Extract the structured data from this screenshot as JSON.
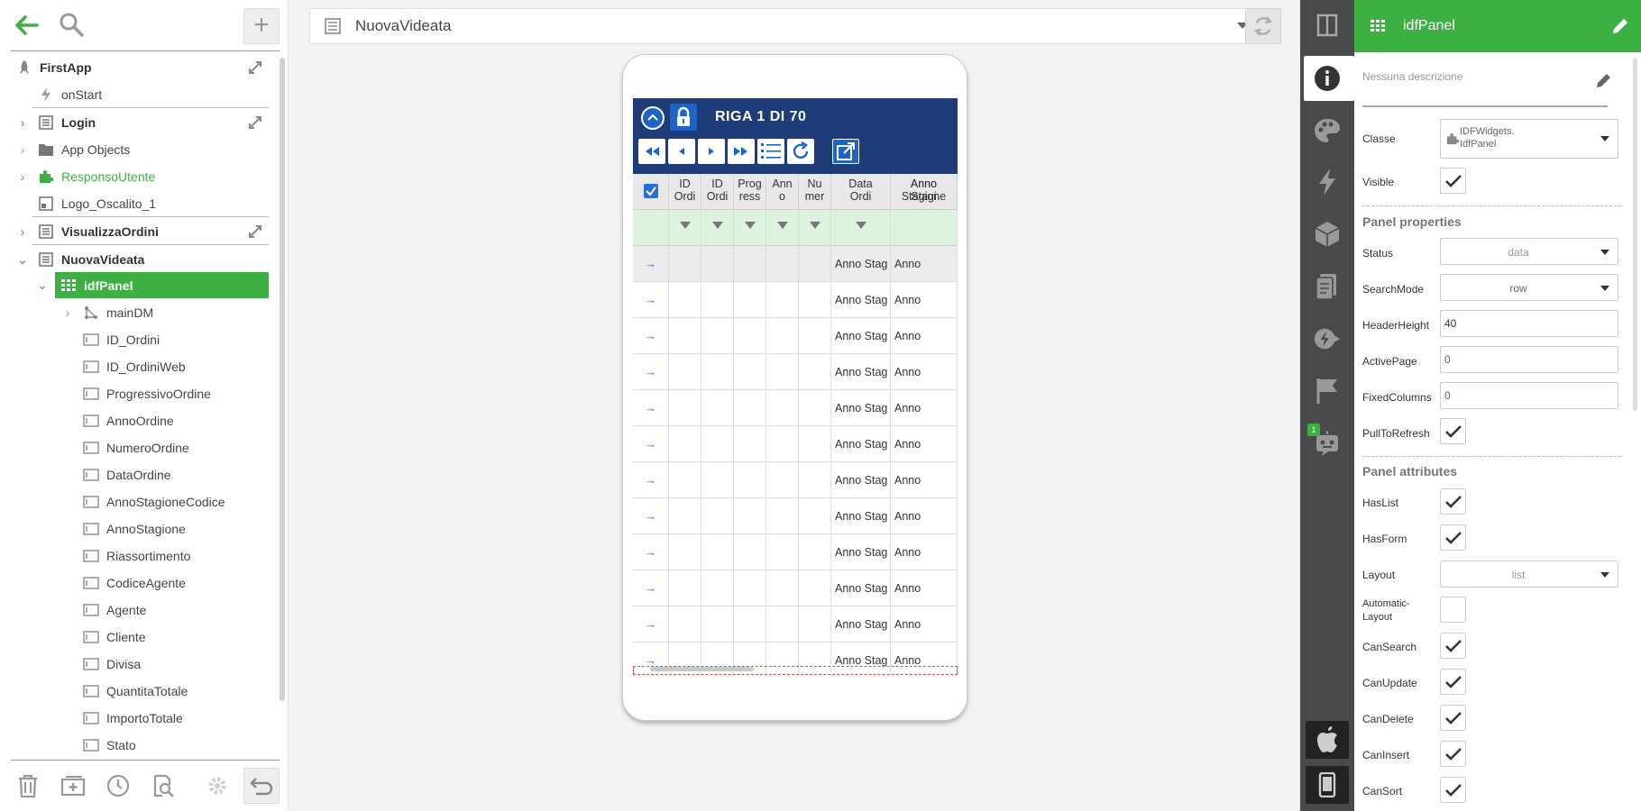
{
  "left": {
    "tree": [
      {
        "label": "FirstApp",
        "bold": true
      },
      {
        "label": "onStart"
      },
      {
        "label": "Login",
        "bold": true
      },
      {
        "label": "App Objects"
      },
      {
        "label": "ResponsoUtente"
      },
      {
        "label": "Logo_Oscalito_1"
      },
      {
        "label": "VisualizzaOrdini",
        "bold": true
      },
      {
        "label": "NuovaVideata",
        "bold": true
      },
      {
        "label": "idfPanel"
      },
      {
        "label": "mainDM"
      },
      {
        "label": "ID_Ordini"
      },
      {
        "label": "ID_OrdiniWeb"
      },
      {
        "label": "ProgressivoOrdine"
      },
      {
        "label": "AnnoOrdine"
      },
      {
        "label": "NumeroOrdine"
      },
      {
        "label": "DataOrdine"
      },
      {
        "label": "AnnoStagioneCodice"
      },
      {
        "label": "AnnoStagione"
      },
      {
        "label": "Riassortimento"
      },
      {
        "label": "CodiceAgente"
      },
      {
        "label": "Agente"
      },
      {
        "label": "Cliente"
      },
      {
        "label": "Divisa"
      },
      {
        "label": "QuantitaTotale"
      },
      {
        "label": "ImportoTotale"
      },
      {
        "label": "Stato"
      }
    ]
  },
  "center": {
    "view_select": "NuovaVideata",
    "phone": {
      "title": "RIGA 1 DI 70",
      "headers": [
        "ID\nOrdi",
        "ID\nOrdi",
        "Prog\nress",
        "Ann\no",
        "Nu\nmer",
        "Data\nOrdi",
        "Anno\nStagione",
        "Anno\nStagi"
      ],
      "row_text_1": "Anno Stag",
      "row_text_2": "Anno",
      "rows": 12
    }
  },
  "right": {
    "panel_name": "idfPanel",
    "description_placeholder": "Nessuna descrizione",
    "class_label": "Classe",
    "class_value_1": "IDFWidgets.",
    "class_value_2": "IdfPanel",
    "visible_label": "Visible",
    "section_props": "Panel properties",
    "status_label": "Status",
    "status_value": "data",
    "searchmode_label": "SearchMode",
    "searchmode_value": "row",
    "headerheight_label": "HeaderHeight",
    "headerheight_value": "40",
    "activepage_label": "ActivePage",
    "activepage_value": "0",
    "fixedcolumns_label": "FixedColumns",
    "fixedcolumns_value": "0",
    "pulltorefresh_label": "PullToRefresh",
    "section_attrs": "Panel attributes",
    "haslist_label": "HasList",
    "hasform_label": "HasForm",
    "layout_label": "Layout",
    "layout_value": "list",
    "automaticlayout_label_1": "Automatic-",
    "automaticlayout_label_2": "Layout",
    "cansearch_label": "CanSearch",
    "canupdate_label": "CanUpdate",
    "candelete_label": "CanDelete",
    "caninsert_label": "CanInsert",
    "cansort_label": "CanSort",
    "badge": "1"
  },
  "colors": {
    "accent": "#3cb043",
    "phone_header": "#1e3d78",
    "toolbar_dark": "#4a4a4a"
  }
}
